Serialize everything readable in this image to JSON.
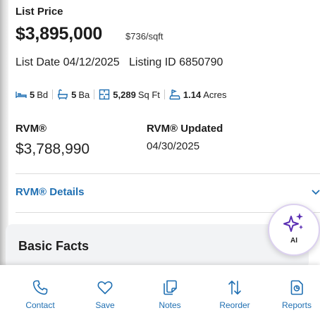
{
  "listing": {
    "list_price_label": "List Price",
    "price": "$3,895,000",
    "per_sqft": "$736/sqft",
    "list_date_line": "List Date 04/12/2025   Listing ID 6850790"
  },
  "facts": {
    "beds_value": "5",
    "beds_unit": "Bd",
    "baths_value": "5",
    "baths_unit": "Ba",
    "sqft_value": "5,289",
    "sqft_unit": "Sq Ft",
    "acres_value": "1.14",
    "acres_unit": "Acres"
  },
  "rvm": {
    "label": "RVM®",
    "value": "$3,788,990",
    "updated_label": "RVM® Updated",
    "updated_value": "04/30/2025",
    "details_link": "RVM® Details"
  },
  "sections": {
    "basic_facts_title": "Basic Facts"
  },
  "ai_button": {
    "label": "AI"
  },
  "bottom_nav": {
    "contact": "Contact",
    "save": "Save",
    "notes": "Notes",
    "reorder": "Reorder",
    "reports": "Reports"
  },
  "colors": {
    "link_blue": "#1f6fb2",
    "ai_purple": "#5b2fb3",
    "card_bg": "#f2f3f5"
  },
  "icons": {
    "beds": "bed-icon",
    "baths": "bathtub-icon",
    "sqft": "floorplan-icon",
    "acres": "lot-icon",
    "details": "chevron-down-icon",
    "ai": "sparkles-icon",
    "contact": "phone-icon",
    "save": "heart-icon",
    "notes": "notes-icon",
    "reorder": "reorder-arrows-icon",
    "reports": "report-document-icon"
  }
}
